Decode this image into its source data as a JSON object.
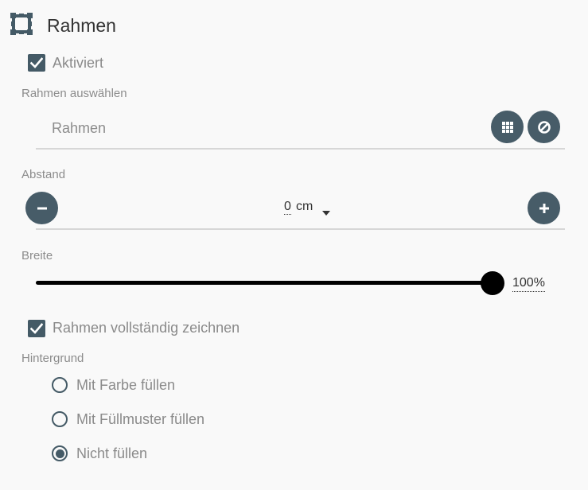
{
  "header": {
    "title": "Rahmen",
    "icon": "frame-icon"
  },
  "enabled": {
    "label": "Aktiviert",
    "checked": true
  },
  "frame_select": {
    "label": "Rahmen auswählen",
    "placeholder": "Rahmen",
    "gallery_icon": "grid-icon",
    "none_icon": "prohibited-icon"
  },
  "spacing": {
    "label": "Abstand",
    "value": "0",
    "unit": "cm",
    "decrease_icon": "minus-icon",
    "increase_icon": "plus-icon"
  },
  "width": {
    "label": "Breite",
    "value_text": "100%",
    "value": 100
  },
  "draw_full": {
    "label": "Rahmen vollständig zeichnen",
    "checked": true
  },
  "background": {
    "label": "Hintergrund",
    "options": [
      {
        "label": "Mit Farbe füllen",
        "selected": false
      },
      {
        "label": "Mit Füllmuster füllen",
        "selected": false
      },
      {
        "label": "Nicht füllen",
        "selected": true
      }
    ]
  },
  "colors": {
    "accent": "#445a66",
    "background": "#f9f9f9",
    "text_muted": "#8a8a8a",
    "text_dark": "#333333"
  }
}
